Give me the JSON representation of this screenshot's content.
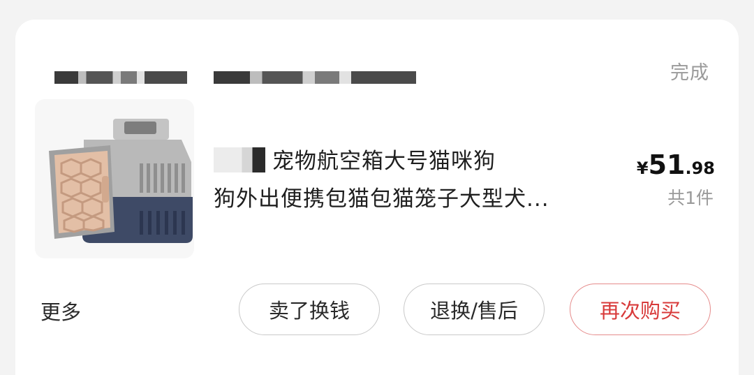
{
  "order": {
    "status": "完成",
    "product_title_line1": "宠物航空箱大号猫咪狗",
    "product_title_line2": "狗外出便携包猫包猫笼子大型犬...",
    "price_currency": "¥",
    "price_integer": "51",
    "price_decimal": ".98",
    "quantity_text": "共1件",
    "product_image_icon": "pet-carrier-icon"
  },
  "actions": {
    "more_label": "更多",
    "sell_label": "卖了换钱",
    "refund_label": "退换/售后",
    "rebuy_label": "再次购买"
  },
  "colors": {
    "accent": "#d83a3a",
    "accent_border": "#e58b8b",
    "muted_text": "#9a9a9a"
  }
}
